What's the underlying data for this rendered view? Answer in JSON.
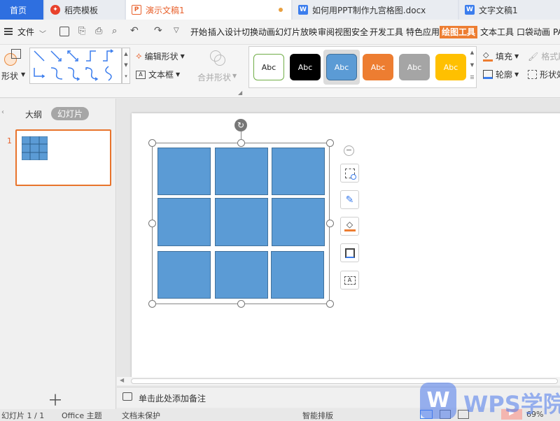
{
  "tabs": [
    {
      "label": "首页",
      "active": true
    },
    {
      "label": "稻壳模板"
    },
    {
      "label": "演示文稿1"
    },
    {
      "label": "如何用PPT制作九宫格图.docx"
    },
    {
      "label": "文字文稿1"
    }
  ],
  "menubar": {
    "file_label": "文件",
    "items": [
      "开始",
      "插入",
      "设计",
      "切换",
      "动画",
      "幻灯片放映",
      "审阅",
      "视图",
      "安全",
      "开发工具",
      "特色应用",
      "绘图工具",
      "文本工具",
      "口袋动画",
      "PA"
    ]
  },
  "ribbon": {
    "shape_label": "形状",
    "edit_shape_label": "编辑形状",
    "textbox_label": "文本框",
    "merge_shape_label": "合并形状",
    "style_samples": [
      {
        "label": "Abc",
        "bg": "#ffffff",
        "fg": "#222222",
        "border": "#70ad47"
      },
      {
        "label": "Abc",
        "bg": "#000000",
        "fg": "#ffffff",
        "border": "#000000"
      },
      {
        "label": "Abc",
        "bg": "#5b9bd5",
        "fg": "#ffffff",
        "border": "#41719c"
      },
      {
        "label": "Abc",
        "bg": "#ed7d31",
        "fg": "#ffffff",
        "border": "#ed7d31"
      },
      {
        "label": "Abc",
        "bg": "#a5a5a5",
        "fg": "#ffffff",
        "border": "#a5a5a5"
      },
      {
        "label": "Abc",
        "bg": "#ffc000",
        "fg": "#ffffff",
        "border": "#ffc000"
      }
    ],
    "fill_label": "填充",
    "format_brush_label": "格式刷",
    "outline_label": "轮廓",
    "shape_effect_label": "形状效"
  },
  "leftpanel": {
    "outline_tab": "大纲",
    "slides_tab": "幻灯片",
    "slide_number": "1",
    "add_icon": "plus-icon"
  },
  "notes": {
    "placeholder": "单击此处添加备注"
  },
  "statusbar": {
    "slide_info": "幻灯片 1 / 1",
    "theme": "Office 主题",
    "backup": "文档未保护",
    "smart": "智能排版",
    "zoom": "69%"
  },
  "watermark": {
    "text": "WPS学院"
  },
  "colors": {
    "accent": "#5b9bd5",
    "active_menu": "#ed7d31",
    "tab_active": "#2e6fe0"
  }
}
